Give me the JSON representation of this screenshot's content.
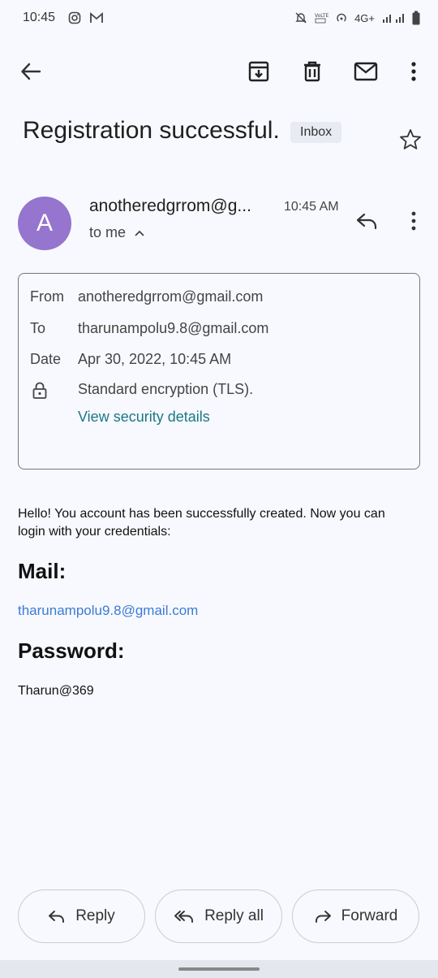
{
  "status_bar": {
    "time": "10:45",
    "network_label": "4G+",
    "left_icons": [
      "instagram-icon",
      "gmail-icon"
    ],
    "right_icons": [
      "bell-off-icon",
      "volte-icon",
      "hotspot-icon",
      "signal-icon",
      "battery-icon"
    ]
  },
  "toolbar": {
    "icons": [
      "back-arrow-icon",
      "archive-icon",
      "delete-icon",
      "mark-unread-icon",
      "more-vert-icon"
    ]
  },
  "email": {
    "subject": "Registration successful.",
    "label": "Inbox",
    "avatar_letter": "A",
    "avatar_color": "#9575cd",
    "sender_display": "anotheredgrrom@g...",
    "time": "10:45 AM",
    "recipient_summary": "to me"
  },
  "details": {
    "from_label": "From",
    "from_value": "anotheredgrrom@gmail.com",
    "to_label": "To",
    "to_value": "tharunampolu9.8@gmail.com",
    "date_label": "Date",
    "date_value": "Apr 30, 2022, 10:45 AM",
    "encryption": "Standard encryption (TLS).",
    "security_link": "View security details"
  },
  "body": {
    "greeting": "Hello! You account has been successfully created. Now you can login with your credentials:",
    "mail_heading": "Mail:",
    "mail_value": "tharunampolu9.8@gmail.com",
    "password_heading": "Password:",
    "password_value": "Tharun@369"
  },
  "actions": {
    "reply": "Reply",
    "reply_all": "Reply all",
    "forward": "Forward"
  },
  "colors": {
    "background": "#f7f9fe",
    "link": "#3c7bd4",
    "security_link": "#1a7885"
  }
}
